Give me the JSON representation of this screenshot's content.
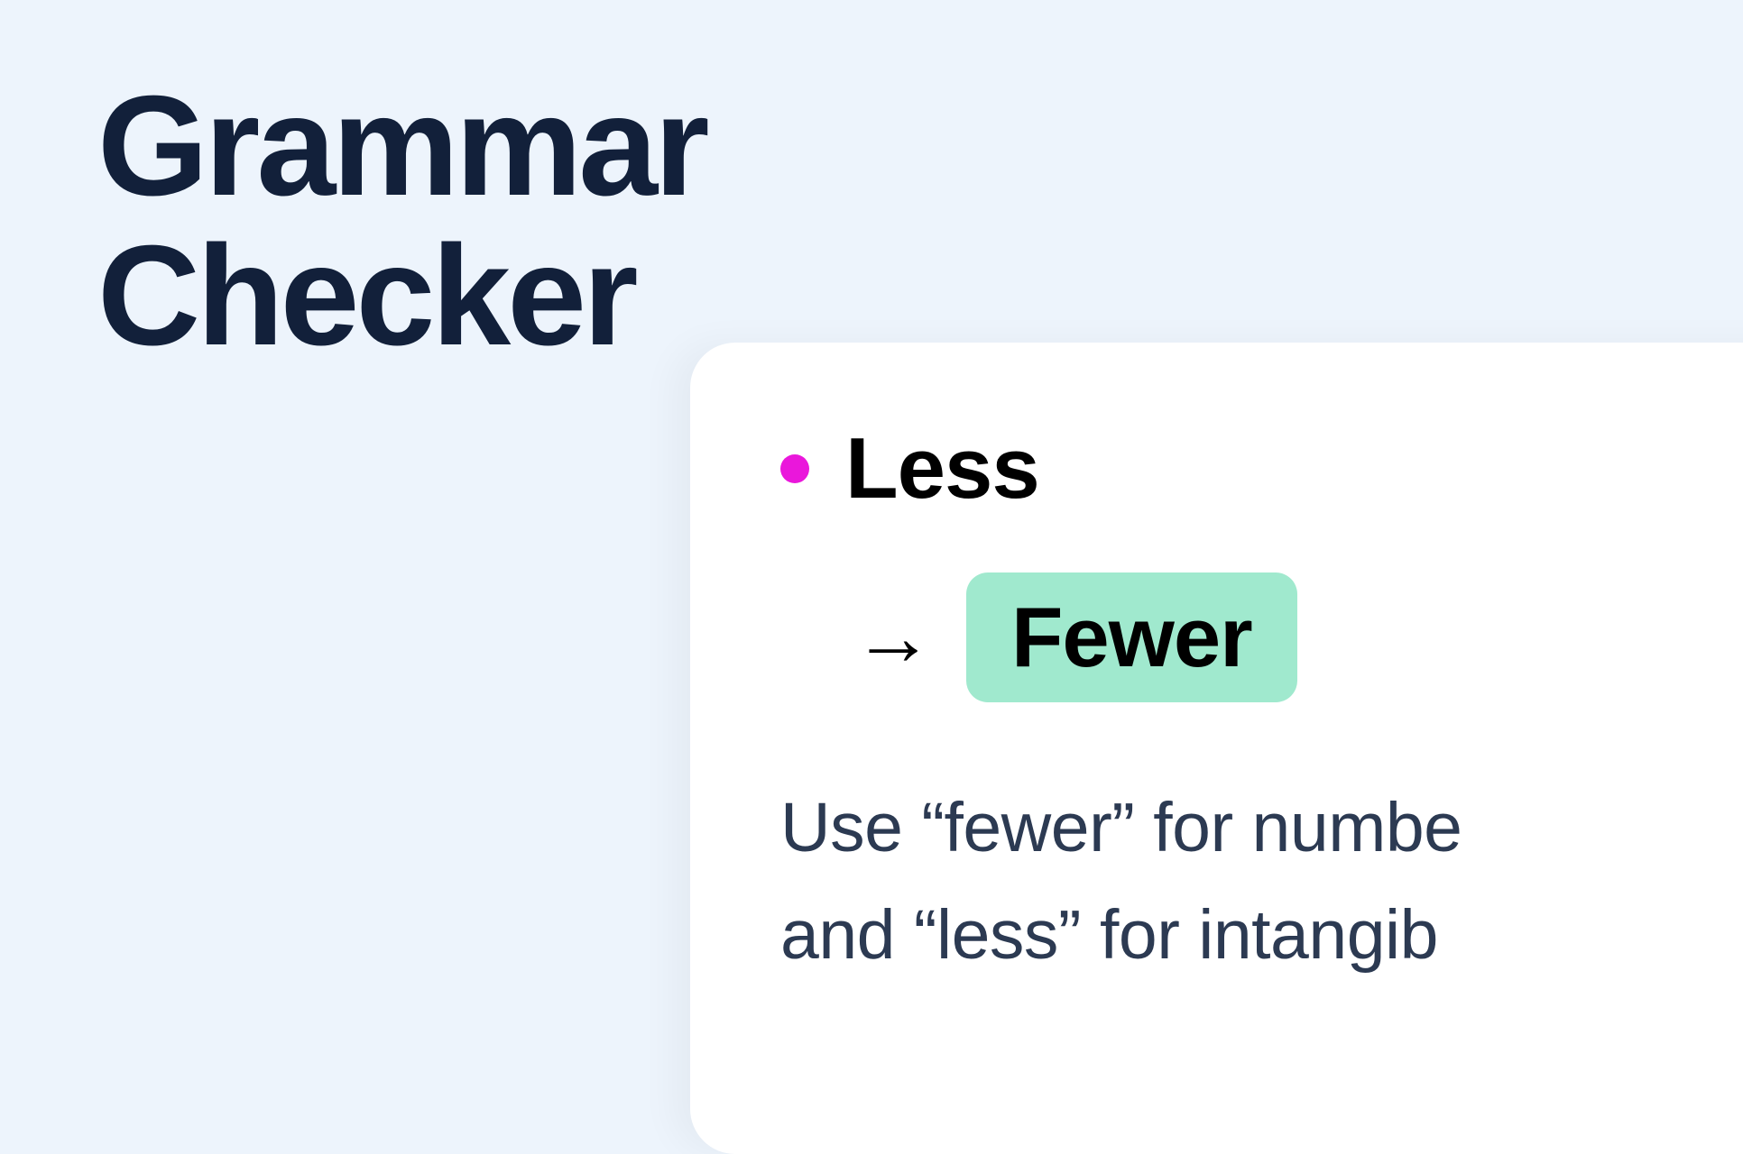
{
  "app": {
    "title_line1": "Grammar",
    "title_line2": "Checker"
  },
  "suggestion": {
    "original": "Less",
    "replacement": "Fewer",
    "explanation_line1": "Use “fewer” for numbe",
    "explanation_line2": "and “less” for intangib"
  },
  "colors": {
    "background": "#edf4fc",
    "title": "#12203a",
    "dot": "#ea17db",
    "highlight": "#a0e9ce",
    "explanation": "#2c3a52"
  }
}
